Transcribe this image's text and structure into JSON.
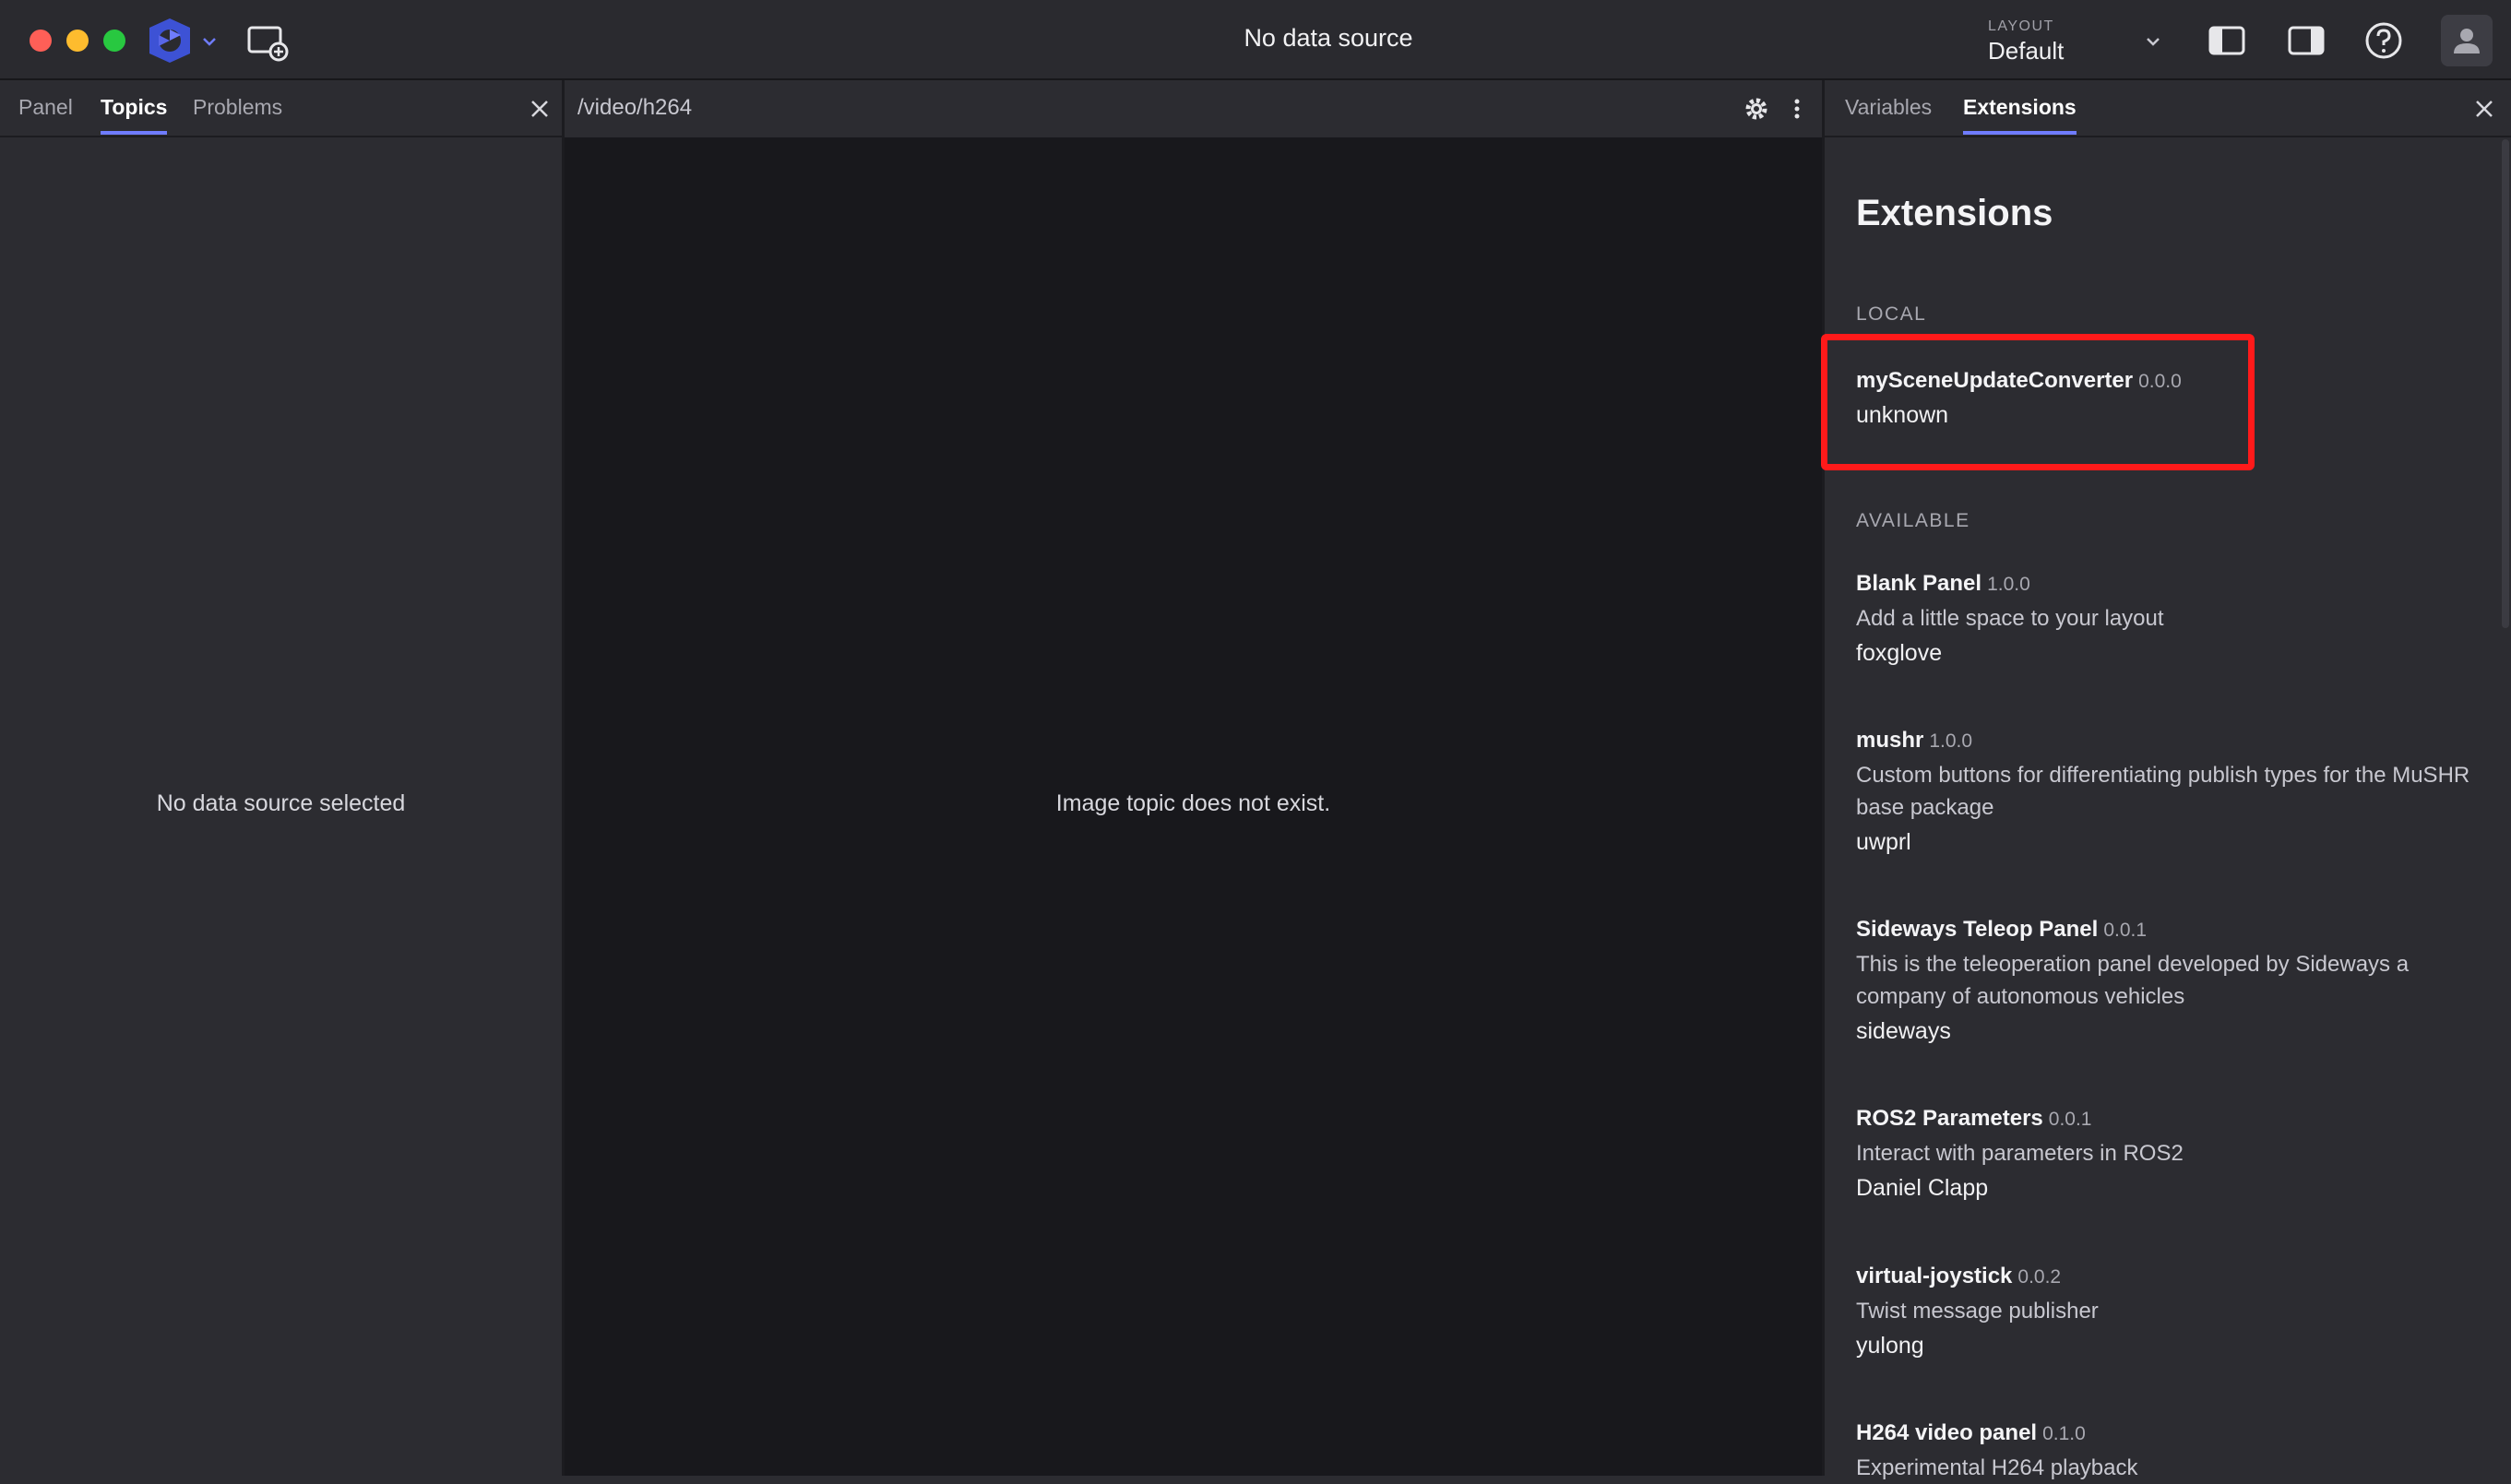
{
  "titlebar": {
    "title": "No data source",
    "layout_label": "LAYOUT",
    "layout_value": "Default"
  },
  "left_panel": {
    "tabs": [
      {
        "label": "Panel",
        "active": false
      },
      {
        "label": "Topics",
        "active": true
      },
      {
        "label": "Problems",
        "active": false
      }
    ],
    "empty_message": "No data source selected"
  },
  "center_panel": {
    "topic_path": "/video/h264",
    "message": "Image topic does not exist."
  },
  "right_panel": {
    "tabs": [
      {
        "label": "Variables",
        "active": false
      },
      {
        "label": "Extensions",
        "active": true
      }
    ],
    "heading": "Extensions",
    "local_label": "LOCAL",
    "available_label": "AVAILABLE",
    "local": [
      {
        "name": "mySceneUpdateConverter",
        "version": "0.0.0",
        "publisher": "unknown"
      }
    ],
    "available": [
      {
        "name": "Blank Panel",
        "version": "1.0.0",
        "description": "Add a little space to your layout",
        "publisher": "foxglove"
      },
      {
        "name": "mushr",
        "version": "1.0.0",
        "description": "Custom buttons for differentiating publish types for the MuSHR base package",
        "publisher": "uwprl"
      },
      {
        "name": "Sideways Teleop Panel",
        "version": "0.0.1",
        "description": "This is the teleoperation panel developed by Sideways a company of autonomous vehicles",
        "publisher": "sideways"
      },
      {
        "name": "ROS2 Parameters",
        "version": "0.0.1",
        "description": "Interact with parameters in ROS2",
        "publisher": "Daniel Clapp"
      },
      {
        "name": "virtual-joystick",
        "version": "0.0.2",
        "description": "Twist message publisher",
        "publisher": "yulong"
      },
      {
        "name": "H264 video panel",
        "version": "0.1.0",
        "description": "Experimental H264 playback",
        "publisher": ""
      }
    ]
  },
  "colors": {
    "accent": "#6f7cff",
    "highlight": "#ff1a1a"
  }
}
